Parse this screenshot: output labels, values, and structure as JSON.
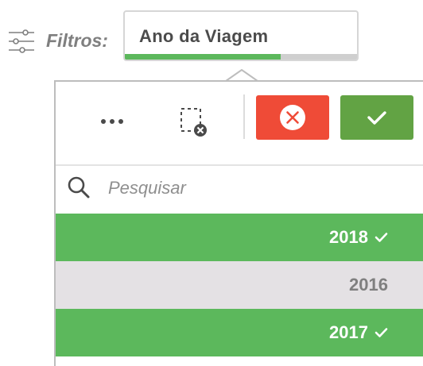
{
  "filter": {
    "icon": "sliders-icon",
    "label": "Filtros:"
  },
  "field": {
    "title": "Ano da Viagem",
    "progress_fraction": 0.67
  },
  "toolbar": {
    "more_icon": "ellipsis-icon",
    "clear_icon": "clear-selection-icon",
    "cancel_icon": "close-circle-icon",
    "confirm_icon": "check-icon"
  },
  "search": {
    "icon": "search-icon",
    "placeholder": "Pesquisar",
    "value": ""
  },
  "list": {
    "items": [
      {
        "label": "2018",
        "selected": true
      },
      {
        "label": "2016",
        "selected": false
      },
      {
        "label": "2017",
        "selected": true
      }
    ]
  },
  "colors": {
    "selected_bg": "#5cb85c",
    "unselected_bg": "#e4e1e4",
    "cancel": "#ef4b37",
    "confirm": "#62a344",
    "progress": "#5cb85c"
  }
}
